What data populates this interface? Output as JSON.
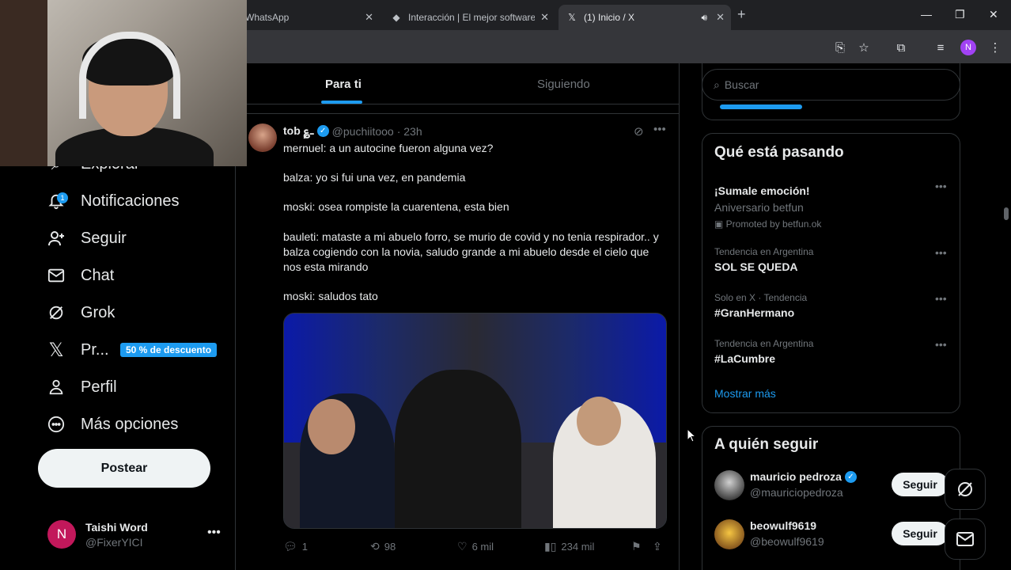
{
  "browser": {
    "tabs": [
      {
        "title": "WhatsApp",
        "icon": "whatsapp-icon"
      },
      {
        "title": "Interacción | El mejor software p",
        "icon": "diamond-icon"
      },
      {
        "title": "(1) Inicio / X",
        "icon": "x-logo-icon"
      }
    ]
  },
  "sidebar": {
    "nav": [
      {
        "label": "Explorar",
        "icon": "search-icon"
      },
      {
        "label": "Notificaciones",
        "icon": "bell-icon",
        "badge": "1"
      },
      {
        "label": "Seguir",
        "icon": "follow-icon"
      },
      {
        "label": "Chat",
        "icon": "mail-icon"
      },
      {
        "label": "Grok",
        "icon": "grok-icon"
      },
      {
        "label": "Pr...",
        "icon": "x-logo-icon",
        "badge": "50 % de descuento"
      },
      {
        "label": "Perfil",
        "icon": "person-icon"
      },
      {
        "label": "Más opciones",
        "icon": "more-circle-icon"
      }
    ],
    "post_button": "Postear",
    "account": {
      "initial": "N",
      "name": "Taishi Word",
      "handle": "@FixerYICI"
    }
  },
  "main": {
    "tabs": [
      "Para ti",
      "Siguiendo"
    ],
    "tweet": {
      "name": "tob ؏ـ",
      "handle": "@puchiitooo",
      "time": "· 23h",
      "lines": [
        "mernuel: a un autocine fueron alguna vez?",
        "balza: yo si fui una vez, en pandemia",
        "moski: osea rompiste la cuarentena, esta bien",
        "bauleti: mataste a mi abuelo forro, se murio de covid y no tenia respirador.. y balza cogiendo con la novia, saludo grande a mi abuelo desde el cielo que nos esta mirando",
        "moski: saludos tato"
      ],
      "stats": {
        "replies": "1",
        "reposts": "98",
        "likes": "6 mil",
        "views": "234 mil"
      }
    }
  },
  "right": {
    "search_placeholder": "Buscar",
    "trends_title": "Qué está pasando",
    "trends": [
      {
        "title": "¡Sumale emoción!",
        "sub": "Aniversario betfun",
        "promo": "Promoted by betfun.ok"
      },
      {
        "meta": "Tendencia en Argentina",
        "title": "SOL SE QUEDA"
      },
      {
        "meta": "Solo en X · Tendencia",
        "title": "#GranHermano"
      },
      {
        "meta": "Tendencia en Argentina",
        "title": "#LaCumbre"
      }
    ],
    "show_more": "Mostrar más",
    "follow_title": "A quién seguir",
    "follow": [
      {
        "name": "mauricio pedroza",
        "handle": "@mauriciopedroza",
        "verified": true,
        "button": "Seguir"
      },
      {
        "name": "beowulf9619",
        "handle": "@beowulf9619",
        "verified": false,
        "button": "Seguir"
      }
    ]
  },
  "colors": {
    "accent": "#1d9bf0",
    "background": "#000000",
    "border": "#2f3336",
    "muted": "#71767b"
  }
}
